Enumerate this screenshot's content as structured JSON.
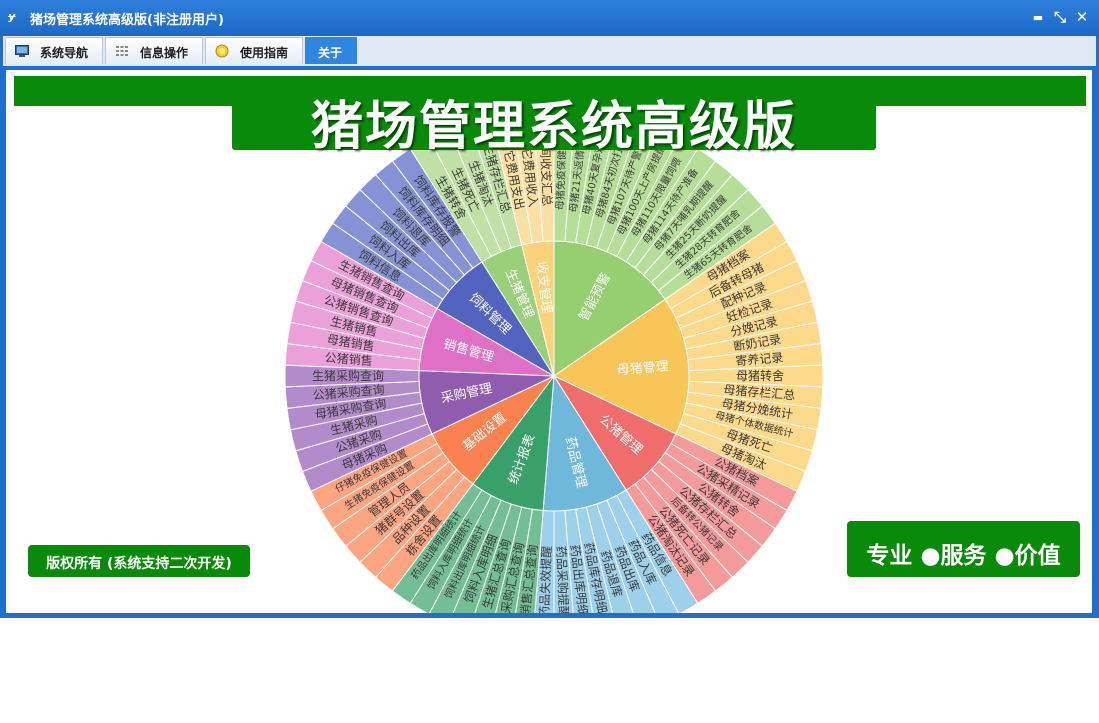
{
  "window": {
    "title": "猪场管理系统高级版(非注册用户)",
    "app_icon_glyph": "ɏ",
    "minimize_glyph": "▬",
    "restore_glyph": "⤡",
    "close_glyph": "✕"
  },
  "menu": {
    "tabs": [
      {
        "label": "系统导航",
        "icon": "monitor-icon"
      },
      {
        "label": "信息操作",
        "icon": "grid-icon"
      },
      {
        "label": "使用指南",
        "icon": "help-icon"
      },
      {
        "label": "关于",
        "icon": ""
      }
    ]
  },
  "banner": {
    "title": "猪场管理系统高级版"
  },
  "footer": {
    "copyright": "版权所有 (系统支持二次开发)",
    "slogan": "专业 ●服务 ●价值"
  },
  "colors": {
    "title_bar": "#1e6fcf",
    "banner_green": "#0a8a0a",
    "active_tab": "#2f86e0"
  },
  "sunburst": {
    "categories": [
      {
        "label": "智能预警",
        "color": "#95cf70",
        "light": "#b5df98",
        "items": [
          "母猪免疫保健提醒",
          "母猪21天返情观察",
          "母猪40天复孕观察",
          "母猪84天初次打胎",
          "母猪107天待产警告",
          "母猪100天上产房提醒",
          "母猪110天限量饲喂",
          "母猪114天待产准备",
          "母猪7天哺乳期提醒",
          "生猪25天断奶提醒",
          "生猪28天转育肥舍",
          "生猪65天转育肥舍"
        ]
      },
      {
        "label": "母猪管理",
        "color": "#f8c558",
        "light": "#fcd98b",
        "items": [
          "母猪档案",
          "后备转母猪",
          "配种记录",
          "妊检记录",
          "分娩记录",
          "断奶记录",
          "寄养记录",
          "母猪转舍",
          "母猪存栏汇总",
          "母猪分娩统计",
          "母猪个体数据统计",
          "母猪死亡",
          "母猪淘汰"
        ]
      },
      {
        "label": "公猪管理",
        "color": "#f06d6d",
        "light": "#f59a9a",
        "items": [
          "公猪档案",
          "公猪采精记录",
          "公猪转舍",
          "公猪存栏汇总",
          "后备转公猪记录",
          "公猪死亡记录",
          "公猪淘汰记录"
        ]
      },
      {
        "label": "药品管理",
        "color": "#6fb8dc",
        "light": "#9dd0ea",
        "items": [
          "药品信息",
          "药品入库",
          "药品出库",
          "药品退库",
          "药品库存明细",
          "药品出库明细",
          "药品采购提醒",
          "药品失效提醒"
        ]
      },
      {
        "label": "统计报表",
        "color": "#39a06a",
        "light": "#72bf94",
        "items": [
          "销售汇总查询",
          "采购汇总查询",
          "生猪汇总查询",
          "饲料入库明细",
          "饲料出库明细统计",
          "饲料入库明细统计",
          "药品出库明细统计"
        ]
      },
      {
        "label": "基础设置",
        "color": "#fb8150",
        "light": "#fda480",
        "items": [
          "栋舍设置",
          "品种设置",
          "猪群号设置",
          "管理人员",
          "生猪免疫保健设置",
          "仔猪免疫保健设置"
        ]
      },
      {
        "label": "采购管理",
        "color": "#8f5cb0",
        "light": "#b38bcb",
        "items": [
          "母猪采购",
          "公猪采购",
          "生猪采购",
          "母猪采购查询",
          "公猪采购查询",
          "生猪采购查询"
        ]
      },
      {
        "label": "销售管理",
        "color": "#de70c6",
        "light": "#eba0da",
        "items": [
          "公猪销售",
          "母猪销售",
          "生猪销售",
          "公猪销售查询",
          "母猪销售查询",
          "生猪销售查询"
        ]
      },
      {
        "label": "饲料管理",
        "color": "#5264c0",
        "light": "#8593d6",
        "items": [
          "饲料信息",
          "饲料入库",
          "饲料出库",
          "饲料退库",
          "饲料库存明细",
          "饲料库存报警"
        ]
      },
      {
        "label": "生猪管理",
        "color": "#9bd07a",
        "light": "#bfe1a6",
        "items": [
          "生猪转舍",
          "生猪死亡",
          "生猪淘汰",
          "生猪存栏汇总"
        ]
      },
      {
        "label": "收支管理",
        "color": "#f9d27a",
        "light": "#fbe0a4",
        "items": [
          "其它费用支出",
          "其它费用收入",
          "期间收支汇总"
        ]
      }
    ]
  }
}
